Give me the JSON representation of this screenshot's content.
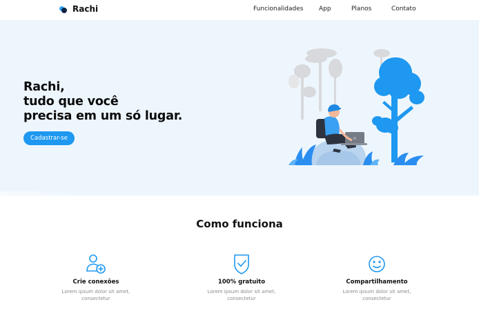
{
  "brand": {
    "name": "Rachi",
    "logo_icon": "rachi-logo-icon"
  },
  "nav": {
    "items": [
      {
        "label": "Funcionalidades"
      },
      {
        "label": "App"
      },
      {
        "label": "Planos"
      },
      {
        "label": "Contato"
      }
    ]
  },
  "hero": {
    "title_lines": [
      "Rachi,",
      "tudo que você",
      "precisa em um só lugar."
    ],
    "cta_label": "Cadastrar-se",
    "illustration": "person-with-laptop-under-tree-illustration"
  },
  "how_it_works": {
    "title": "Como funciona",
    "features": [
      {
        "icon": "user-add-icon",
        "title": "Crie conexões",
        "desc_line1": "Lorem ipsum dolor sit amet,",
        "desc_line2": "consectetur"
      },
      {
        "icon": "shield-check-icon",
        "title": "100% gratuito",
        "desc_line1": "Lorem ipsum dolor sit amet,",
        "desc_line2": "consectetur"
      },
      {
        "icon": "smile-icon",
        "title": "Compartilhamento",
        "desc_line1": "Lorem ipsum dolor sit amet,",
        "desc_line2": "consectetur"
      }
    ]
  },
  "colors": {
    "accent": "#1e98f0",
    "hero_bg": "#eef6fd",
    "dark": "#0f2444"
  }
}
